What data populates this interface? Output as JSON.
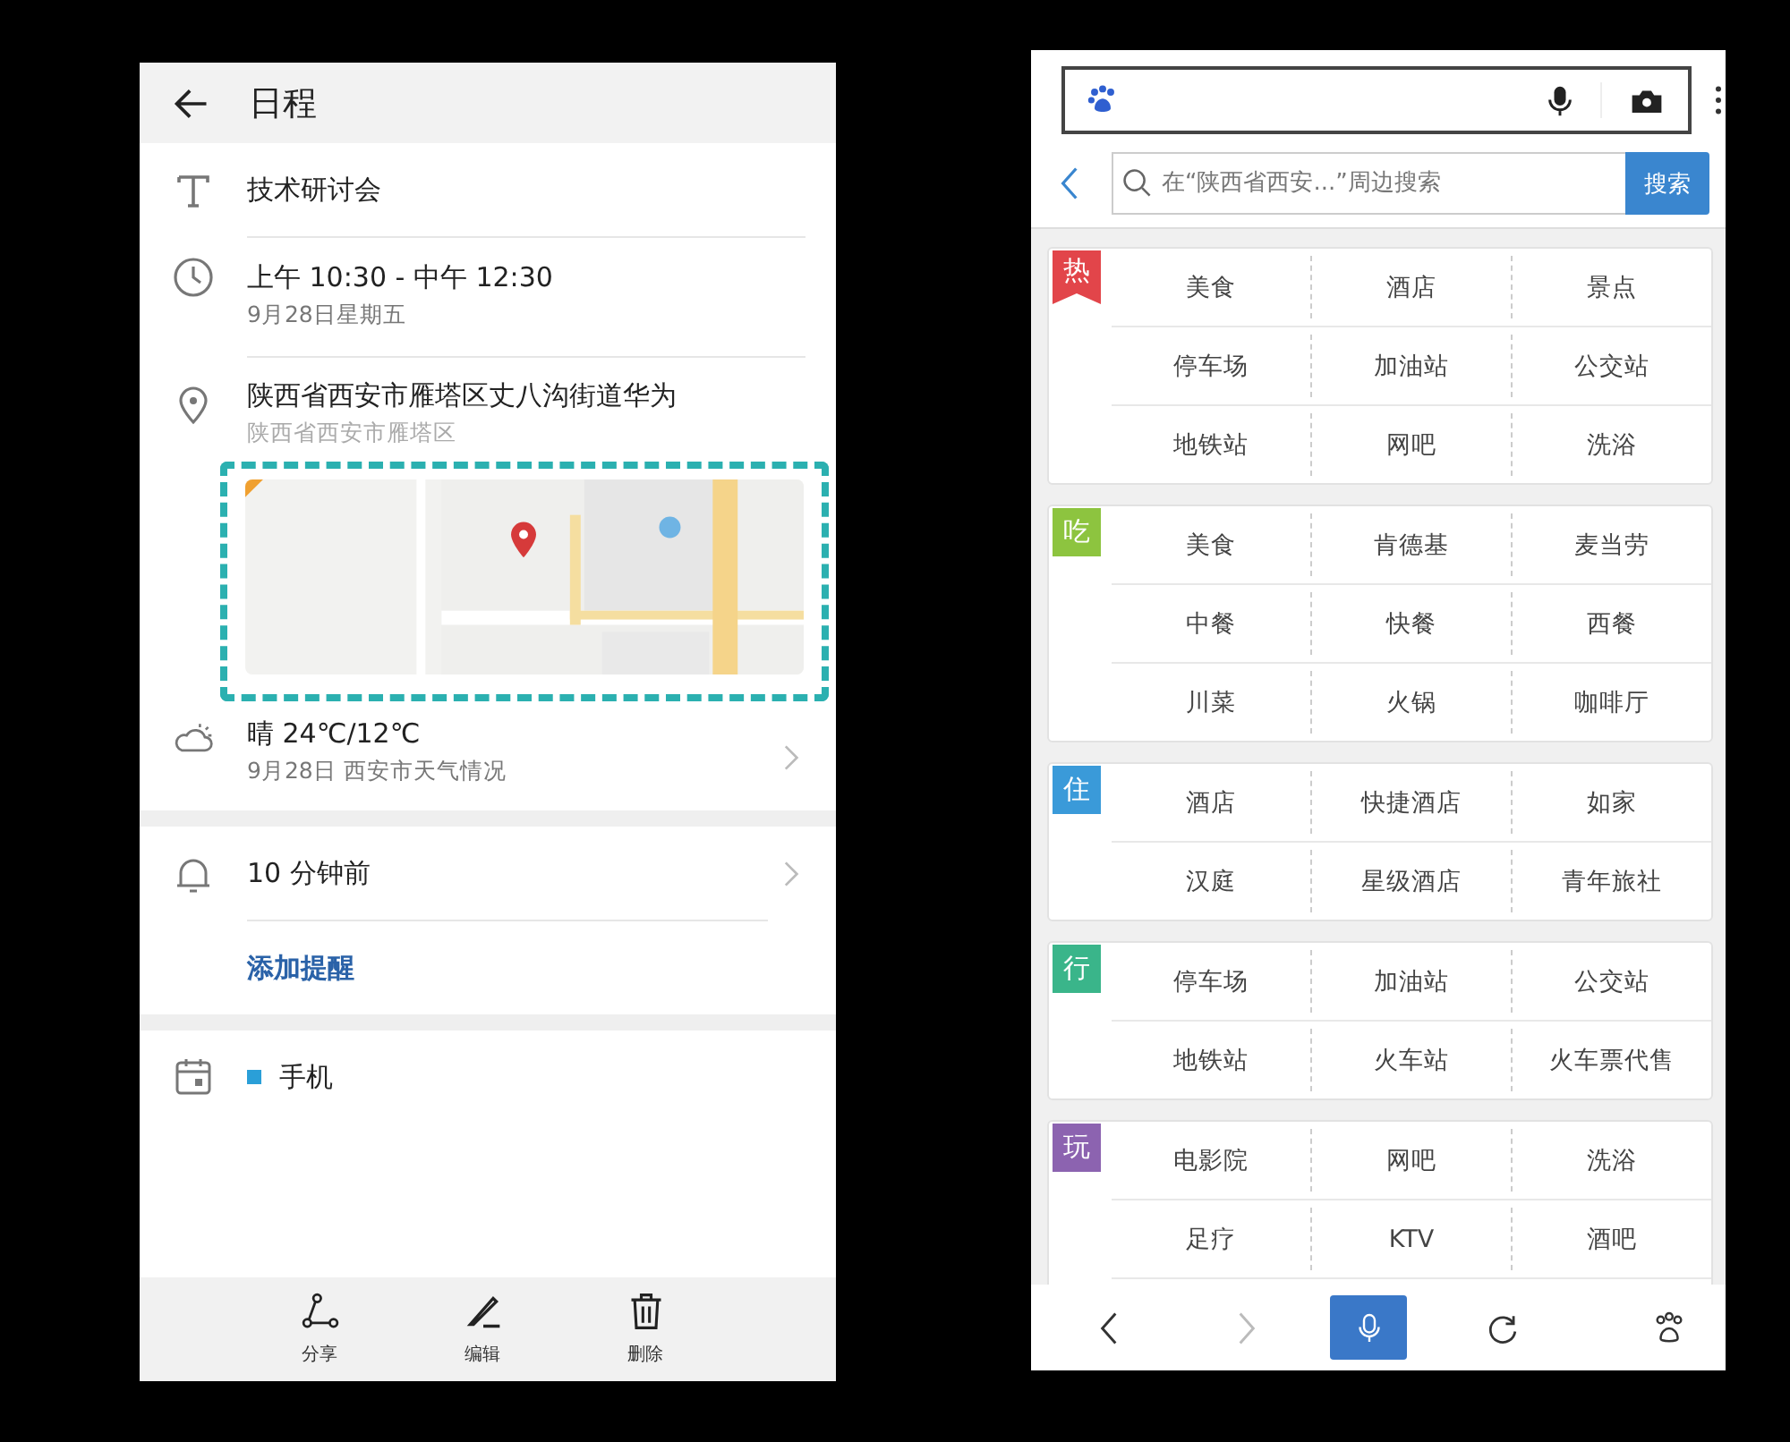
{
  "calendar_screen": {
    "header": {
      "title": "日程"
    },
    "event": {
      "title": "技术研讨会"
    },
    "time": {
      "range": "上午 10:30 - 中午 12:30",
      "date": "9月28日星期五"
    },
    "location": {
      "address": "陕西省西安市雁塔区丈八沟街道华为",
      "area": "陕西省西安市雁塔区"
    },
    "weather": {
      "summary": "晴 24℃/12℃",
      "detail": "9月28日 西安市天气情况"
    },
    "reminders": [
      {
        "text": "10 分钟前"
      }
    ],
    "add_reminder": "添加提醒",
    "calendar": {
      "name": "手机",
      "color": "#2a9fd8"
    },
    "actions": [
      {
        "kind": "share",
        "label": "分享"
      },
      {
        "kind": "edit",
        "label": "编辑"
      },
      {
        "kind": "delete",
        "label": "删除"
      }
    ]
  },
  "map_search_screen": {
    "search": {
      "placeholder": "在“陕西省西安...”周边搜索",
      "button": "搜索"
    },
    "categories": [
      {
        "tag": "热",
        "kind": "ribbon",
        "color": "#e2454a",
        "items": [
          "美食",
          "酒店",
          "景点",
          "停车场",
          "加油站",
          "公交站",
          "地铁站",
          "网吧",
          "洗浴"
        ]
      },
      {
        "tag": "吃",
        "kind": "square",
        "color": "#8dc43f",
        "items": [
          "美食",
          "肯德基",
          "麦当劳",
          "中餐",
          "快餐",
          "西餐",
          "川菜",
          "火锅",
          "咖啡厅"
        ]
      },
      {
        "tag": "住",
        "kind": "square",
        "color": "#3a9ad9",
        "items": [
          "酒店",
          "快捷酒店",
          "如家",
          "汉庭",
          "星级酒店",
          "青年旅社"
        ]
      },
      {
        "tag": "行",
        "kind": "square",
        "color": "#3ab58a",
        "items": [
          "停车场",
          "加油站",
          "公交站",
          "地铁站",
          "火车站",
          "火车票代售"
        ]
      },
      {
        "tag": "玩",
        "kind": "square",
        "color": "#8c63b0",
        "items": [
          "电影院",
          "网吧",
          "洗浴",
          "足疗",
          "KTV",
          "酒吧"
        ],
        "cut_row": true
      }
    ],
    "nav": [
      {
        "kind": "back",
        "disabled": false
      },
      {
        "kind": "forward",
        "disabled": true
      },
      {
        "kind": "voice"
      },
      {
        "kind": "refresh"
      },
      {
        "kind": "home"
      }
    ]
  }
}
